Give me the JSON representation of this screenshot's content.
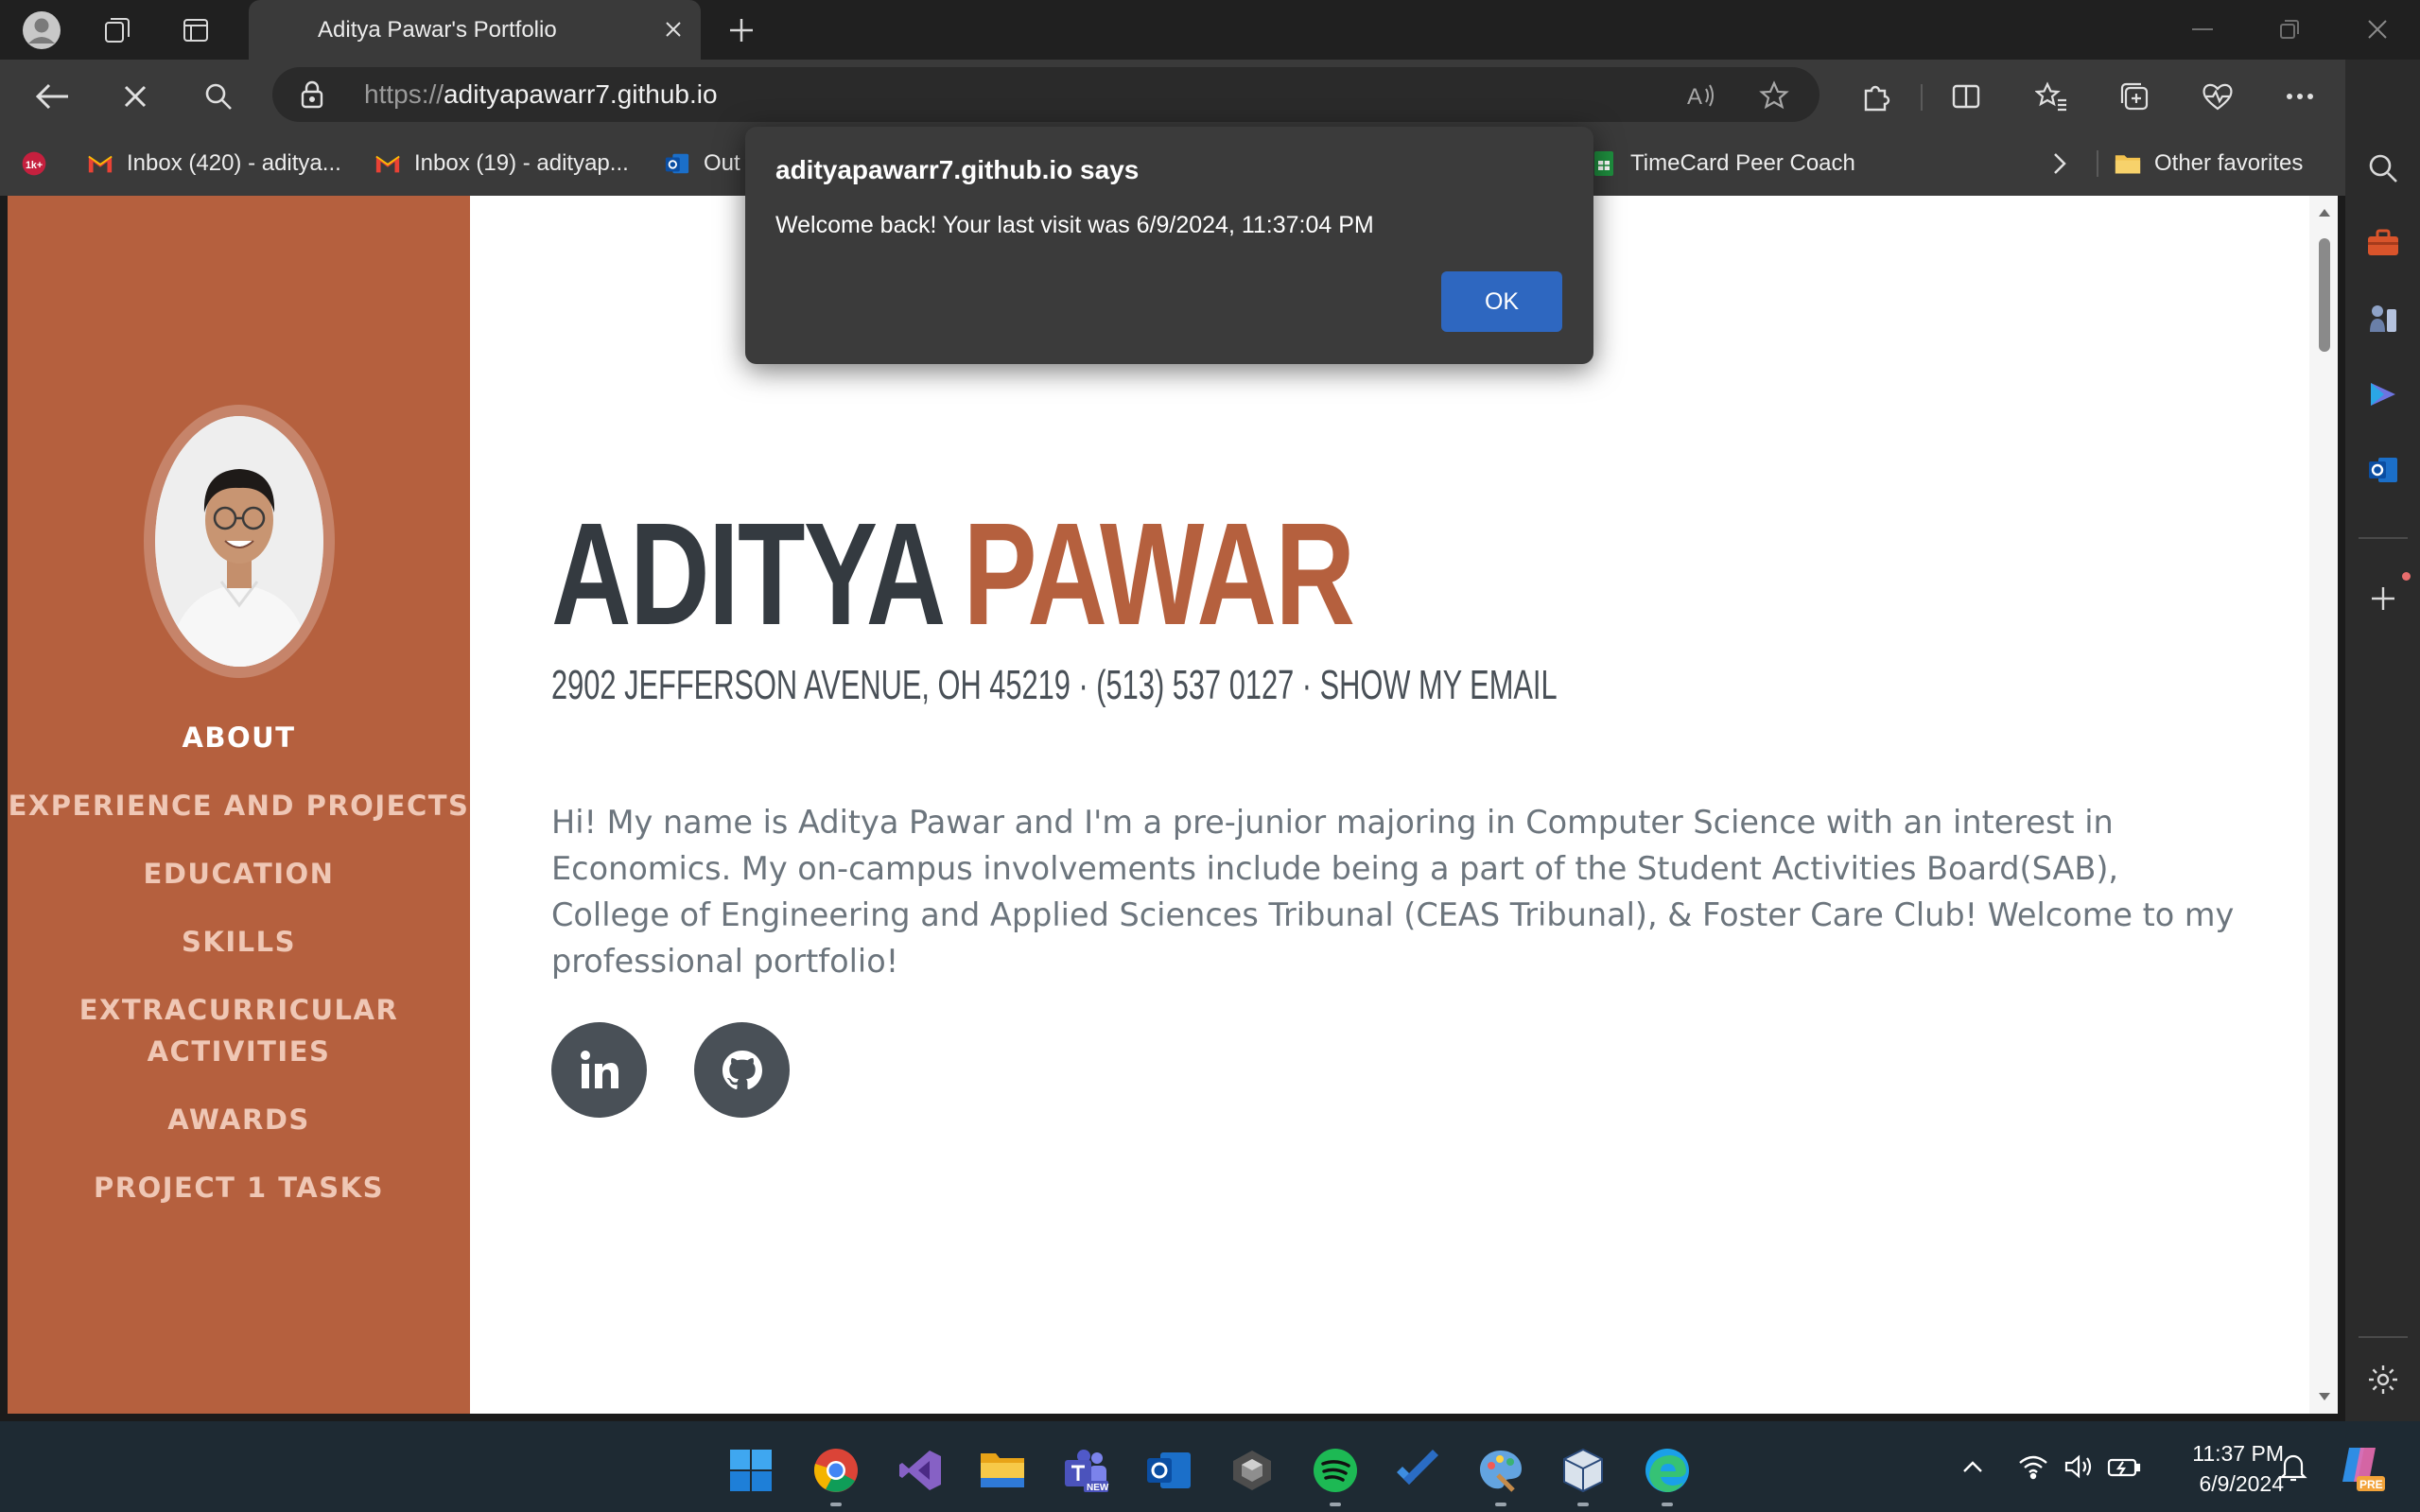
{
  "browser": {
    "tab_title": "Aditya Pawar's Portfolio",
    "url_scheme": "https://",
    "url_host": "adityapawarr7.github.io",
    "read_aloud_label": "A",
    "bookmarks": [
      {
        "label": "",
        "badge": "1k+"
      },
      {
        "label": "Inbox (420) - aditya..."
      },
      {
        "label": "Inbox (19) - adityap..."
      },
      {
        "label": "Out"
      },
      {
        "label": "TimeCard Peer Coach"
      },
      {
        "label": "Other favorites"
      }
    ]
  },
  "alert": {
    "title": "adityapawarr7.github.io says",
    "message": "Welcome back! Your last visit was 6/9/2024, 11:37:04 PM",
    "ok_label": "OK"
  },
  "sidebar": {
    "items": [
      {
        "label": "ABOUT"
      },
      {
        "label": "EXPERIENCE AND PROJECTS"
      },
      {
        "label": "EDUCATION"
      },
      {
        "label": "SKILLS"
      },
      {
        "label": "EXTRACURRICULAR"
      },
      {
        "label": "ACTIVITIES"
      },
      {
        "label": "AWARDS"
      },
      {
        "label": "PROJECT 1 TASKS"
      }
    ]
  },
  "main": {
    "first_name": "ADITYA",
    "last_name": "PAWAR",
    "subheading": "2902 JEFFERSON AVENUE, OH 45219 · (513) 537 0127 · SHOW MY EMAIL",
    "bio": "Hi! My name is Aditya Pawar and I'm a pre-junior majoring in Computer Science with an interest in Economics. My on-campus involvements include being a part of the Student Activities Board(SAB), College of Engineering and Applied Sciences Tribunal (CEAS Tribunal), & Foster Care Club! Welcome to my professional portfolio!",
    "social": [
      {
        "icon": "linkedin-icon"
      },
      {
        "icon": "github-icon"
      }
    ]
  },
  "taskbar": {
    "time": "11:37 PM",
    "date": "6/9/2024",
    "teams_badge": "NEW",
    "copilot_badge": "PRE"
  },
  "colors": {
    "accent": "#b5603e",
    "dark_text": "#343a40",
    "dialog_button": "#2e67c0"
  }
}
